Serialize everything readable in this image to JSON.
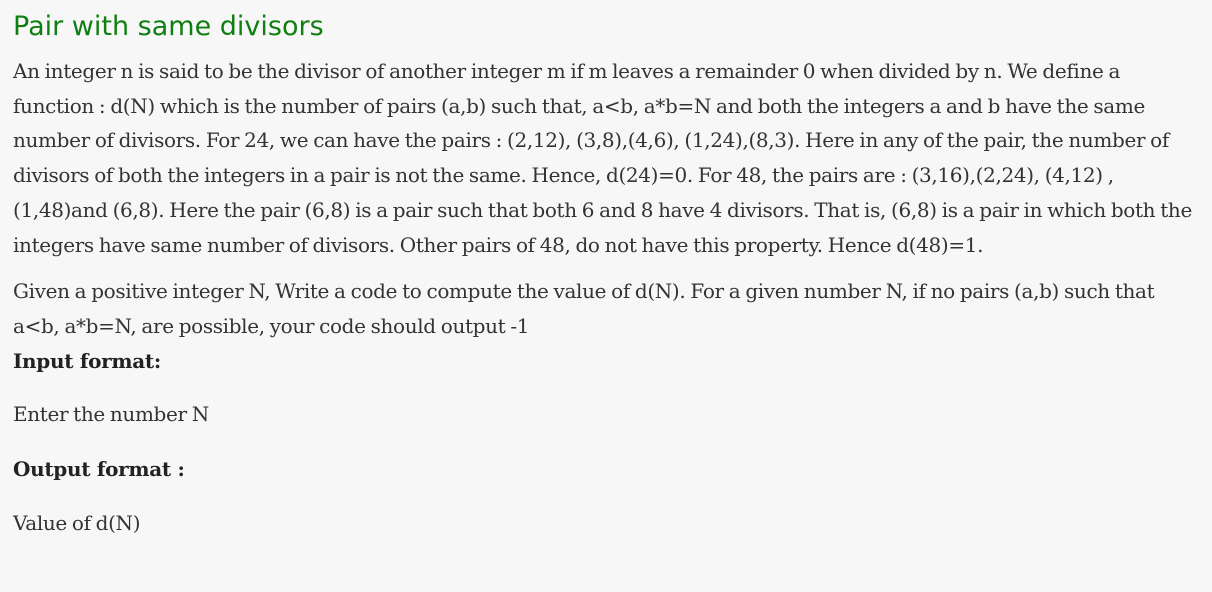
{
  "problem": {
    "title": "Pair with same divisors",
    "description": "An integer n is said to be the divisor of another integer m if m leaves a remainder 0 when divided by n. We define a function : d(N) which is the number of pairs  (a,b) such that, a<b,  a*b=N and both the integers a and b have the same number of divisors.     For 24, we can have the pairs : (2,12), (3,8),(4,6), (1,24),(8,3).  Here in any of the pair, the number of divisors of both the integers in a pair is not the  same. Hence, d(24)=0. For 48, the pairs are : (3,16),(2,24), (4,12) , (1,48)and (6,8). Here the pair (6,8) is a pair such that both 6 and 8 have 4 divisors.  That is, (6,8) is a pair in which both the integers have same number of divisors. Other pairs of 48, do not have this property. Hence d(48)=1.",
    "task": "Given a positive integer N, Write a code to compute the value of d(N).  For a given number N, if no pairs  (a,b) such that a<b, a*b=N, are possible, your code should output -1",
    "input_heading": "Input format:",
    "input_text": "Enter the number N",
    "output_heading": "Output format :",
    "output_text": "Value of d(N)"
  },
  "colors": {
    "title": "#0f7f12",
    "text": "#333333",
    "background": "#f7f7f7"
  }
}
